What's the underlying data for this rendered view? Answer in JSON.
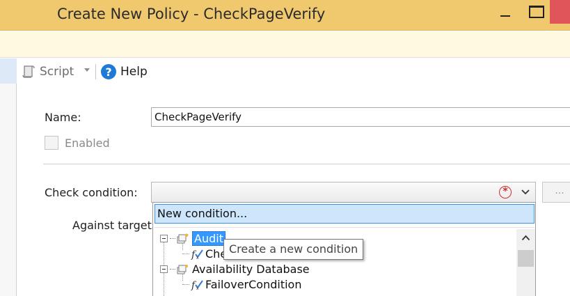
{
  "window": {
    "title": "Create New Policy - CheckPageVerify"
  },
  "toolbar": {
    "script_label": "Script",
    "help_label": "Help"
  },
  "form": {
    "name_label": "Name:",
    "name_value": "CheckPageVerify",
    "enabled_label": "Enabled",
    "enabled_checked": false,
    "check_condition_label": "Check condition:",
    "against_targets_label": "Against targets",
    "ellipsis_label": "..."
  },
  "dropdown": {
    "new_condition_label": "New condition...",
    "tree": [
      {
        "facet": "Audit",
        "selected": true,
        "children": [
          "Che"
        ]
      },
      {
        "facet": "Availability Database",
        "selected": false,
        "children": [
          "FailoverCondition"
        ]
      }
    ]
  },
  "tooltip": {
    "text": "Create a new condition"
  },
  "colors": {
    "titlebar": "#f0c96f",
    "infobar": "#fff9e1",
    "selection": "#3399ff",
    "error": "#d12b2b",
    "close_button": "#e0555a"
  }
}
